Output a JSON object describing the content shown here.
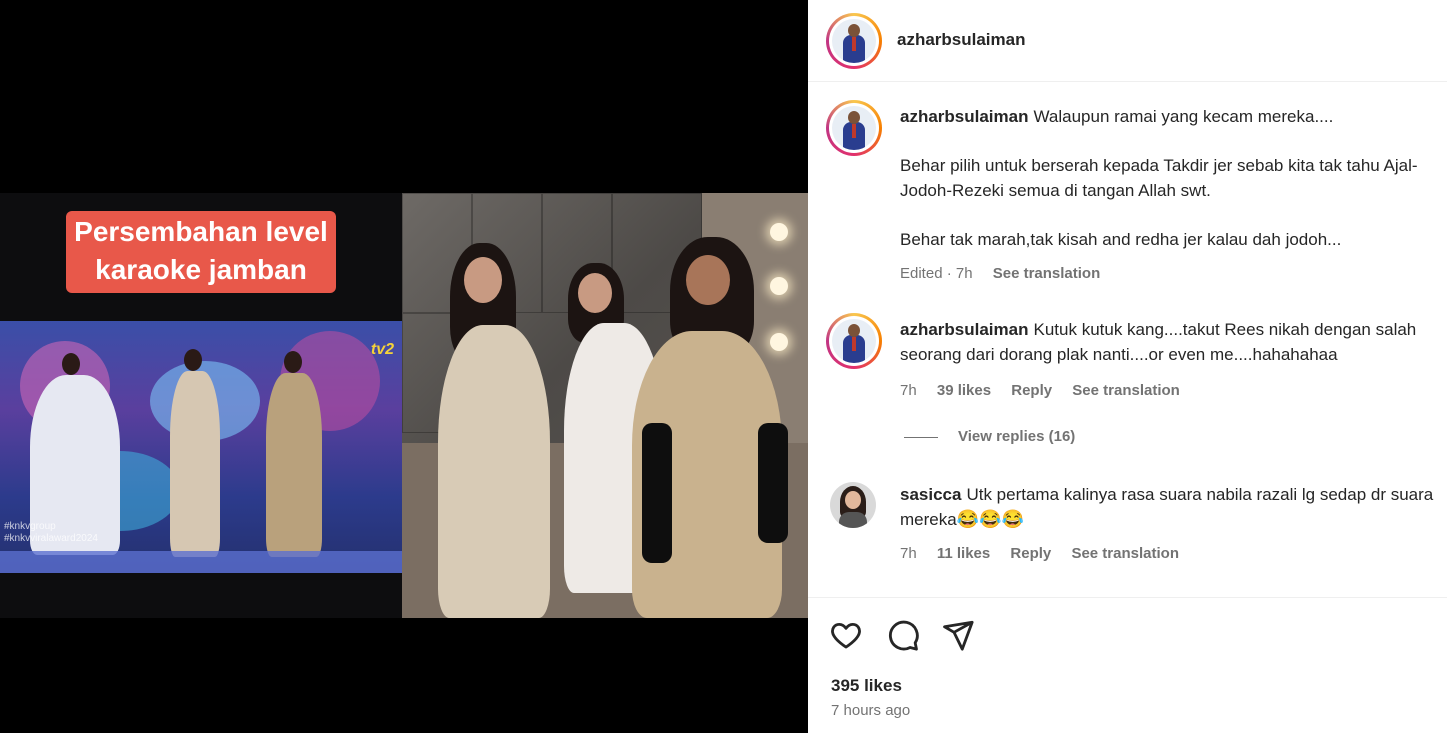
{
  "media": {
    "caption_line1": "Persembahan level",
    "caption_line2": "karaoke jamban",
    "stage_tag1": "#knkvgroup",
    "stage_tag2": "#knkvviralaward2024",
    "tv_logo": "tv2"
  },
  "header": {
    "username": "azharbsulaiman"
  },
  "comments": [
    {
      "username": "azharbsulaiman",
      "paragraphs": [
        "Walaupun ramai yang kecam mereka....",
        "Behar pilih untuk berserah kepada Takdir jer sebab kita tak tahu Ajal-Jodoh-Rezeki semua di tangan Allah swt.",
        "Behar tak marah,tak kisah and redha jer kalau dah jodoh..."
      ],
      "edited": "Edited · 7h",
      "see_translation": "See translation"
    },
    {
      "username": "azharbsulaiman",
      "text": "Kutuk kutuk kang....takut Rees nikah dengan salah seorang dari dorang plak nanti....or even me....hahahahaa",
      "time": "7h",
      "likes": "39 likes",
      "reply": "Reply",
      "see_translation": "See translation",
      "view_replies": "View replies (16)"
    },
    {
      "username": "sasicca",
      "text": "Utk pertama kalinya rasa suara nabila razali lg sedap dr suara mereka",
      "emojis": "😂😂😂",
      "time": "7h",
      "likes": "11 likes",
      "reply": "Reply",
      "see_translation": "See translation"
    }
  ],
  "footer": {
    "likes": "395 likes",
    "time_ago": "7 hours ago",
    "icons": [
      "heart-icon",
      "comment-icon",
      "share-icon"
    ]
  }
}
